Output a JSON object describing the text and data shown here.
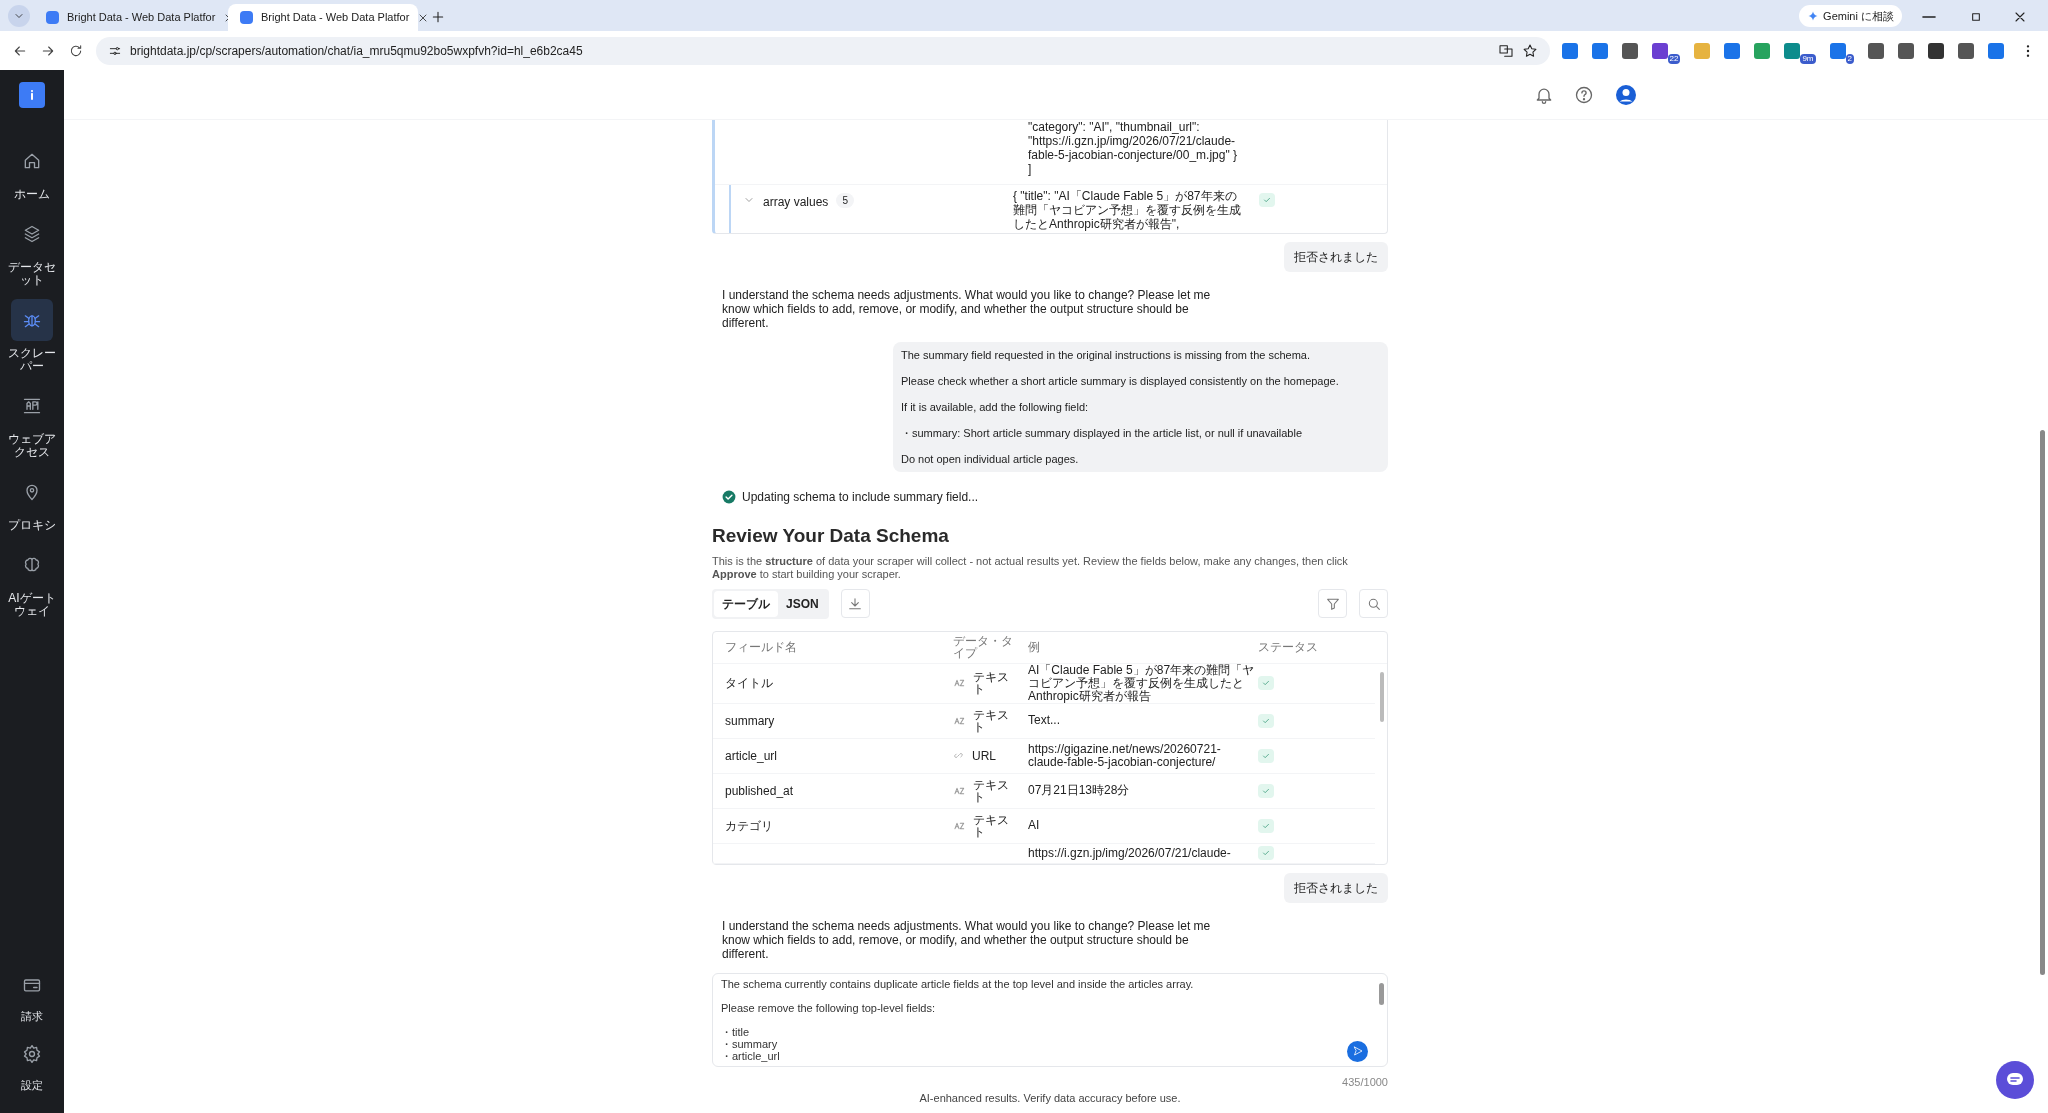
{
  "browser": {
    "tabs": [
      {
        "title": "Bright Data - Web Data Platfor",
        "selected": false
      },
      {
        "title": "Bright Data - Web Data Platfor",
        "selected": true
      }
    ],
    "url": "brightdata.jp/cp/scrapers/automation/chat/ia_mru5qmu92bo5wxpfvh?id=hl_e6b2ca45",
    "gemini_button": "Gemini に相談",
    "extension_badges": [
      "22",
      "9m",
      "2"
    ]
  },
  "sidebar": {
    "items": [
      {
        "label": "ホーム",
        "selected": false
      },
      {
        "label": "データセット",
        "selected": false
      },
      {
        "label": "スクレーパー",
        "selected": true
      },
      {
        "label": "ウェブアクセス",
        "selected": false
      },
      {
        "label": "プロキシ",
        "selected": false
      },
      {
        "label": "AIゲートウェイ",
        "selected": false
      }
    ],
    "bottom_items": [
      {
        "label": "請求"
      },
      {
        "label": "設定"
      }
    ]
  },
  "json_preview": {
    "lines": [
      "\"category\": \"AI\", \"thumbnail_url\":",
      "\"https://i.gzn.jp/img/2026/07/21/claude-",
      "fable-5-jacobian-conjecture/00_m.jpg\" }",
      "]"
    ],
    "array_row": {
      "label": "array values",
      "count": "5",
      "example": "{ \"title\": \"AI「Claude Fable 5」が87年来の難問「ヤコビアン予想」を覆す反例を生成したとAnthropic研究者が報告\",",
      "checked": true
    }
  },
  "messages": [
    {
      "kind": "rejected",
      "text": "拒否されました"
    },
    {
      "kind": "assistant",
      "text": "I understand the schema needs adjustments. What would you like to change? Please let me know which fields to add, remove, or modify, and whether the output structure should be different."
    },
    {
      "kind": "user",
      "paragraphs": [
        "The summary field requested in the original instructions is missing from the schema.",
        "Please check whether a short article summary is displayed consistently on the homepage.",
        "If it is available, add the following field:",
        "・summary: Short article summary displayed in the article list, or null if unavailable",
        "Do not open individual article pages."
      ]
    },
    {
      "kind": "status",
      "text": "Updating schema to include summary field...",
      "done": true
    },
    {
      "kind": "schema",
      "title": "Review Your Data Schema",
      "description": "This is the **structure** of data your scraper will collect - not actual results yet. Review the fields below, make any changes, then click **Approve** to start building your scraper.",
      "view_tabs": [
        {
          "label": "テーブル",
          "selected": true
        },
        {
          "label": "JSON",
          "selected": false
        }
      ],
      "columns": [
        "フィールド名",
        "データ・タイプ",
        "例",
        "ステータス"
      ],
      "rows": [
        {
          "name": "タイトル",
          "type": "テキスト",
          "kind": "text",
          "example": "AI「Claude Fable 5」が87年来の難問「ヤコビアン予想」を覆す反例を生成したとAnthropic研究者が報告",
          "checked": true
        },
        {
          "name": "summary",
          "type": "テキスト",
          "kind": "text",
          "example": "Text...",
          "checked": true
        },
        {
          "name": "article_url",
          "type": "URL",
          "kind": "link",
          "example": "https://gigazine.net/news/20260721-claude-fable-5-jacobian-conjecture/",
          "checked": true
        },
        {
          "name": "published_at",
          "type": "テキスト",
          "kind": "text",
          "example": "07月21日13時28分",
          "checked": true
        },
        {
          "name": "カテゴリ",
          "type": "テキスト",
          "kind": "text",
          "example": "AI",
          "checked": true
        },
        {
          "example": "https://i.gzn.jp/img/2026/07/21/claude-",
          "checked": true
        }
      ]
    },
    {
      "kind": "rejected",
      "text": "拒否されました"
    },
    {
      "kind": "assistant",
      "text": "I understand the schema needs adjustments. What would you like to change? Please let me know which fields to add, remove, or modify, and whether the output structure should be different."
    }
  ],
  "composer": {
    "value": "The schema currently contains duplicate article fields at the top level and inside the articles array.\n\nPlease remove the following top-level fields:\n\n・title\n・summary\n・article_url",
    "counter": "435/1000"
  },
  "footer": "AI-enhanced results. Verify data accuracy before use."
}
